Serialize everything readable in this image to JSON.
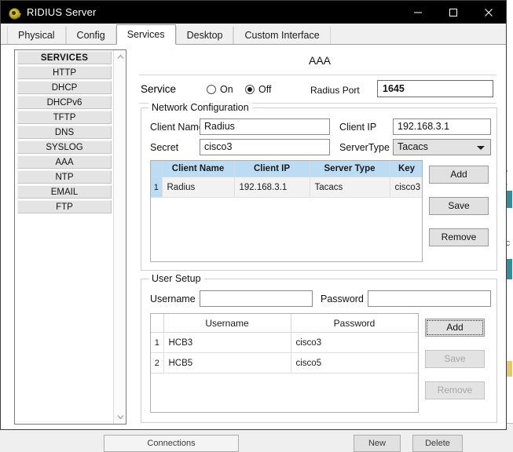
{
  "window": {
    "title": "RIDIUS Server",
    "icon": "app-badge-icon",
    "minimize": "—",
    "maximize": "□",
    "close": "✕"
  },
  "tabs": [
    {
      "label": "Physical",
      "active": false
    },
    {
      "label": "Config",
      "active": false
    },
    {
      "label": "Services",
      "active": true
    },
    {
      "label": "Desktop",
      "active": false
    },
    {
      "label": "Custom Interface",
      "active": false
    }
  ],
  "sidebar": {
    "header": "SERVICES",
    "items": [
      {
        "label": "HTTP"
      },
      {
        "label": "DHCP"
      },
      {
        "label": "DHCPv6"
      },
      {
        "label": "TFTP"
      },
      {
        "label": "DNS"
      },
      {
        "label": "SYSLOG"
      },
      {
        "label": "AAA"
      },
      {
        "label": "NTP"
      },
      {
        "label": "EMAIL"
      },
      {
        "label": "FTP"
      }
    ],
    "scroll_up": "▲",
    "scroll_down": "▼"
  },
  "pane": {
    "title": "AAA",
    "service": {
      "label": "Service",
      "on_label": "On",
      "off_label": "Off",
      "selected": "Off",
      "radius_port_label": "Radius Port",
      "radius_port_value": "1645"
    },
    "network_configuration": {
      "legend": "Network Configuration",
      "client_name_label": "Client Name",
      "client_name_value": "Radius",
      "client_ip_label": "Client IP",
      "client_ip_value": "192.168.3.1",
      "secret_label": "Secret",
      "secret_value": "cisco3",
      "server_type_label": "ServerType",
      "server_type_value": "Tacacs",
      "table": {
        "columns": [
          "",
          "Client Name",
          "Client IP",
          "Server Type",
          "Key"
        ],
        "rows": [
          {
            "num": "1",
            "client_name": "Radius",
            "client_ip": "192.168.3.1",
            "server_type": "Tacacs",
            "key": "cisco3",
            "selected": true
          }
        ]
      },
      "buttons": {
        "add": "Add",
        "save": "Save",
        "remove": "Remove"
      }
    },
    "user_setup": {
      "legend": "User Setup",
      "username_label": "Username",
      "username_value": "",
      "password_label": "Password",
      "password_value": "",
      "table": {
        "columns": [
          "",
          "Username",
          "Password"
        ],
        "rows": [
          {
            "num": "1",
            "username": "HCB3",
            "password": "cisco3"
          },
          {
            "num": "2",
            "username": "HCB5",
            "password": "cisco5"
          }
        ]
      },
      "buttons": {
        "add": "Add",
        "save": "Save",
        "remove": "Remove"
      }
    }
  },
  "background": {
    "connections_button": "Connections",
    "new_button": "New",
    "delete_button": "Delete"
  },
  "colors": {
    "titlebar": "#000000",
    "table_header": "#bcdcf4",
    "selection": "#bcdcf4",
    "window_bg": "#f0f0f0"
  }
}
